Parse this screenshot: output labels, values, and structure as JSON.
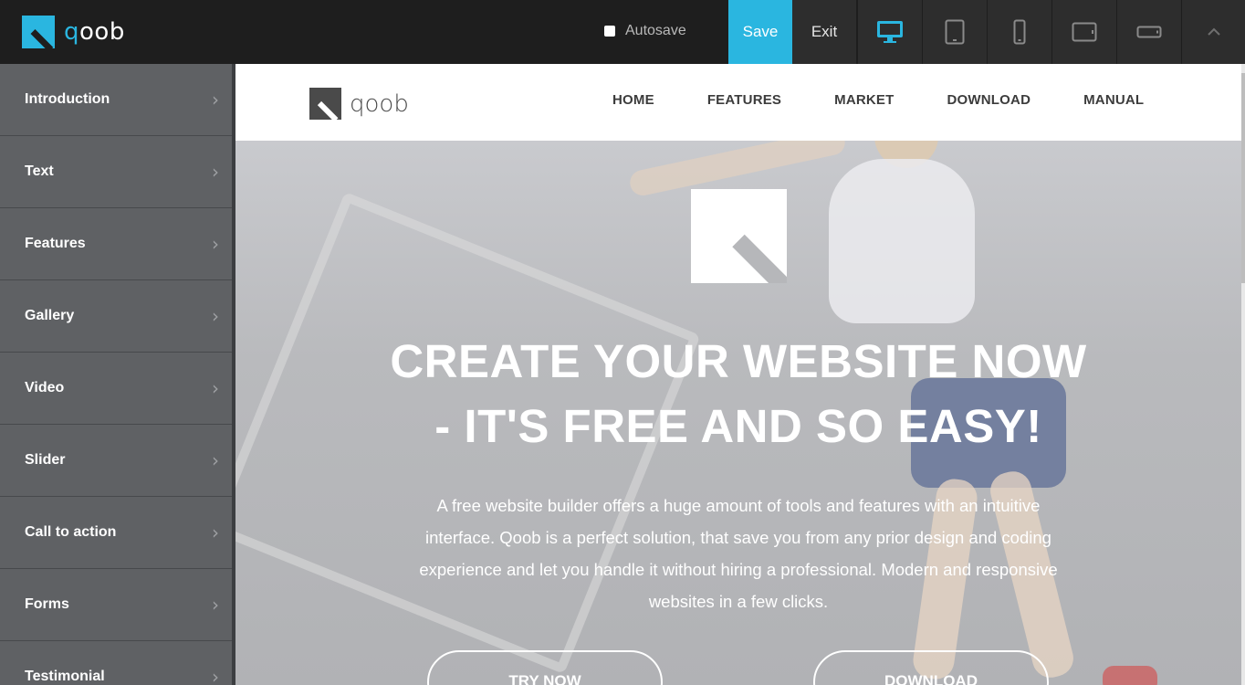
{
  "toolbar": {
    "logo_text_accent": "q",
    "logo_text": "oob",
    "autosave_label": "Autosave",
    "save_label": "Save",
    "exit_label": "Exit",
    "devices": [
      "desktop-icon",
      "tablet-portrait-icon",
      "phone-portrait-icon",
      "tablet-landscape-icon",
      "phone-landscape-icon"
    ],
    "collapse_icon": "chevron-up-icon",
    "accent_color": "#2ab6e0"
  },
  "sidebar": {
    "items": [
      {
        "label": "Introduction"
      },
      {
        "label": "Text"
      },
      {
        "label": "Features"
      },
      {
        "label": "Gallery"
      },
      {
        "label": "Video"
      },
      {
        "label": "Slider"
      },
      {
        "label": "Call to action"
      },
      {
        "label": "Forms"
      },
      {
        "label": "Testimonial"
      }
    ]
  },
  "site": {
    "logo_text": "qoob",
    "nav": [
      "HOME",
      "FEATURES",
      "MARKET",
      "DOWNLOAD",
      "MANUAL"
    ],
    "hero": {
      "title_line1": "CREATE YOUR WEBSITE NOW",
      "title_line2": "- IT'S FREE AND SO EASY!",
      "text": "A free website builder offers a huge amount of tools and features with an intuitive interface. Qoob is a perfect solution, that save you from any prior design and coding experience and let you handle it without hiring a professional. Modern and responsive websites in a few clicks.",
      "try_label": "TRY NOW",
      "download_label": "DOWNLOAD"
    }
  }
}
